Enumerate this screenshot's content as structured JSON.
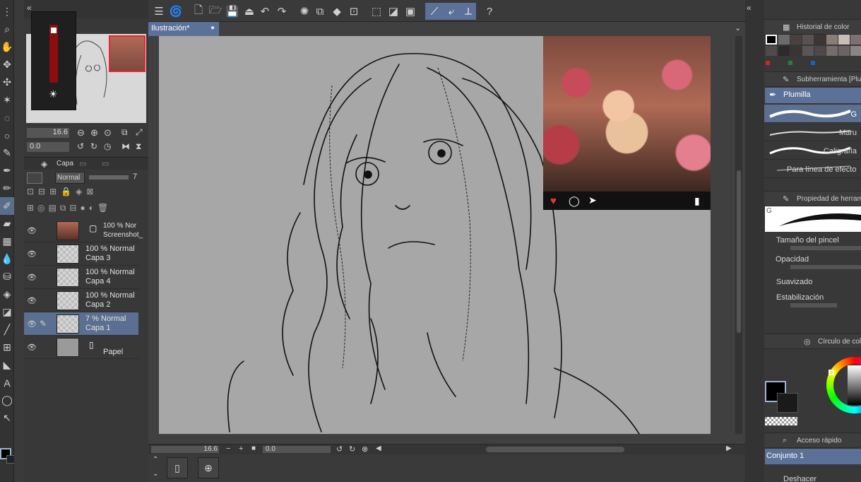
{
  "document": {
    "tab_label": "Ilustración*"
  },
  "navigator": {
    "zoom_value": "16.6",
    "rotate_value": "0.0"
  },
  "layers_panel": {
    "tab_label": "Capa",
    "blend_mode": "Normal",
    "opacity_value": "7",
    "layers": [
      {
        "line1": "100 % Nor",
        "line2": "Screenshot_"
      },
      {
        "line1": "100 % Normal",
        "line2": "Capa 3"
      },
      {
        "line1": "100 % Normal",
        "line2": "Capa 4"
      },
      {
        "line1": "100 % Normal",
        "line2": "Capa 2"
      },
      {
        "line1": "7 % Normal",
        "line2": "Capa 1"
      },
      {
        "line1": "",
        "line2": "Papel"
      }
    ]
  },
  "canvas_status": {
    "zoom_value": "16.6",
    "rotate_value": "0.0"
  },
  "color_history": {
    "title": "Historial de color",
    "swatches": [
      "#000000",
      "#6b6b6b",
      "#4a4040",
      "#5a5252",
      "#3b3535",
      "#8a7d78",
      "#c9bdb5",
      "#7c7074",
      "#4f4a4c",
      "#2e2a2b",
      "#3a3434",
      "#5b5656",
      "#4f4848",
      "#766c6d",
      "#6b6465",
      "#4a4444",
      "#8b8484",
      "#5c5555"
    ],
    "marks": [
      "#c62828",
      "#2e7d32",
      "#1565c0"
    ]
  },
  "sub_tool": {
    "title": "Subherramienta [Plum",
    "group_label": "Plumilla",
    "brushes": [
      "G",
      "Maru",
      "Caligrafía",
      "Para línea de efecto"
    ]
  },
  "tool_property": {
    "title": "Propiedad de herram",
    "brush_letter": "G",
    "rows": [
      "Tamaño del pincel",
      "Opacidad",
      "Suavizado",
      "Estabilización"
    ]
  },
  "color_wheel": {
    "title": "Círculo de colo"
  },
  "quick_access": {
    "title": "Acceso rápido",
    "set_label": "Conjunto 1",
    "next_label": "Deshacer"
  },
  "colors": {
    "accent": "#5b7198",
    "selected": "#5b6f90",
    "canvas_bg": "#a7a7a7",
    "main_color": "#000000",
    "sub_color": "#1a1a1a"
  }
}
